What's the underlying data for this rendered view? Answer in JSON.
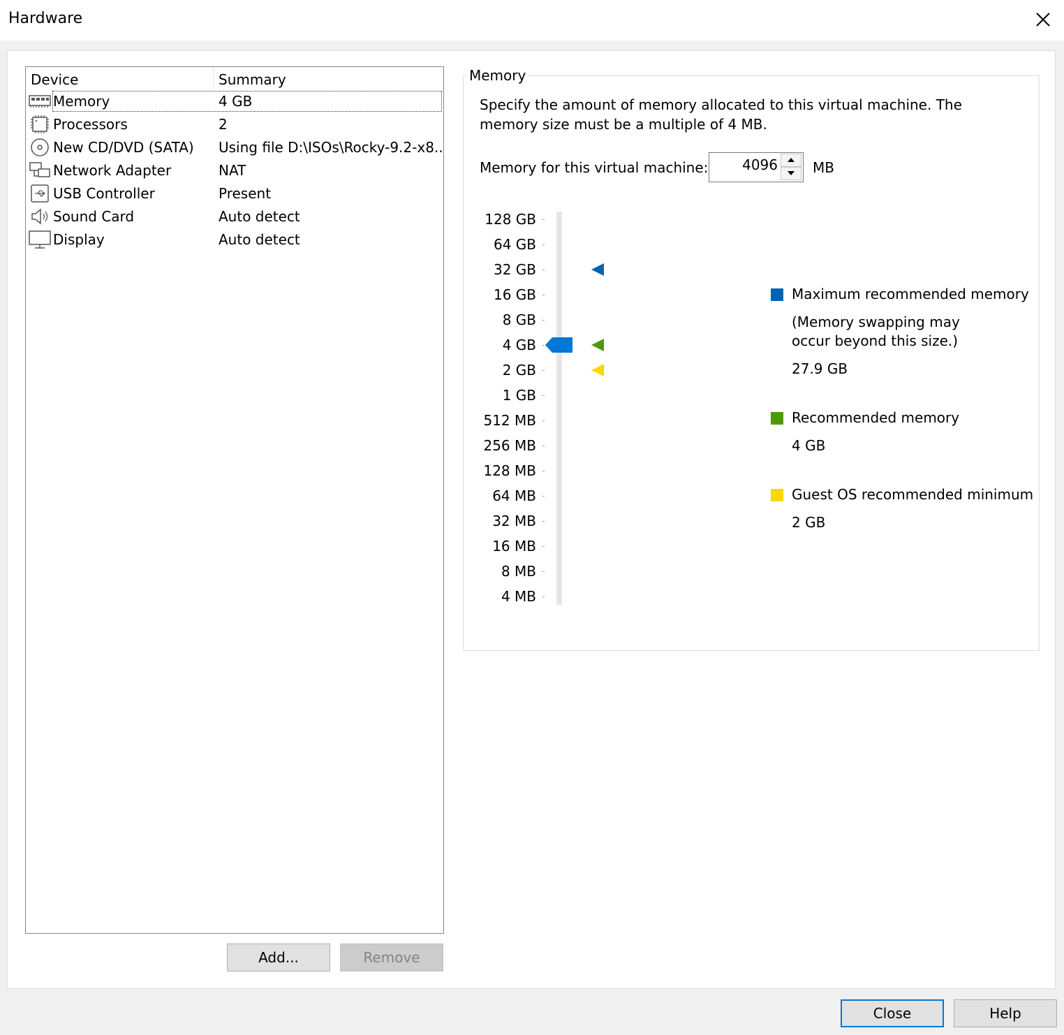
{
  "window": {
    "title": "Hardware"
  },
  "device_list": {
    "columns": {
      "device": "Device",
      "summary": "Summary"
    },
    "items": [
      {
        "name": "Memory",
        "summary": "4 GB",
        "icon": "memory-icon",
        "selected": true
      },
      {
        "name": "Processors",
        "summary": "2",
        "icon": "processor-icon"
      },
      {
        "name": "New CD/DVD (SATA)",
        "summary": "Using file D:\\ISOs\\Rocky-9.2-x8...",
        "icon": "cd-dvd-icon"
      },
      {
        "name": "Network Adapter",
        "summary": "NAT",
        "icon": "network-adapter-icon"
      },
      {
        "name": "USB Controller",
        "summary": "Present",
        "icon": "usb-icon"
      },
      {
        "name": "Sound Card",
        "summary": "Auto detect",
        "icon": "speaker-icon"
      },
      {
        "name": "Display",
        "summary": "Auto detect",
        "icon": "monitor-icon"
      }
    ],
    "add_label": "Add...",
    "remove_label": "Remove"
  },
  "memory": {
    "group_label": "Memory",
    "description": "Specify the amount of memory allocated to this virtual machine. The memory size must be a multiple of 4 MB.",
    "field_label": "Memory for this virtual machine:",
    "value": "4096",
    "unit": "MB",
    "slider": {
      "ticks": [
        "128 GB",
        "64 GB",
        "32 GB",
        "16 GB",
        "8 GB",
        "4 GB",
        "2 GB",
        "1 GB",
        "512 MB",
        "256 MB",
        "128 MB",
        "64 MB",
        "32 MB",
        "16 MB",
        "8 MB",
        "4 MB"
      ],
      "current": "4 GB",
      "markers": {
        "maximum": "32 GB",
        "recommended": "4 GB",
        "guest_minimum": "2 GB"
      }
    },
    "legend": {
      "max": {
        "label": "Maximum recommended memory",
        "note_line1": "(Memory swapping may",
        "note_line2": "occur beyond this size.)",
        "value": "27.9 GB",
        "color": "#0063b1"
      },
      "recommended": {
        "label": "Recommended memory",
        "value": "4 GB",
        "color": "#4e9a06"
      },
      "guest_min": {
        "label": "Guest OS recommended minimum",
        "value": "2 GB",
        "color": "#ffd800"
      }
    },
    "thumb_color": "#0078d7"
  },
  "footer": {
    "close_label": "Close",
    "help_label": "Help"
  }
}
